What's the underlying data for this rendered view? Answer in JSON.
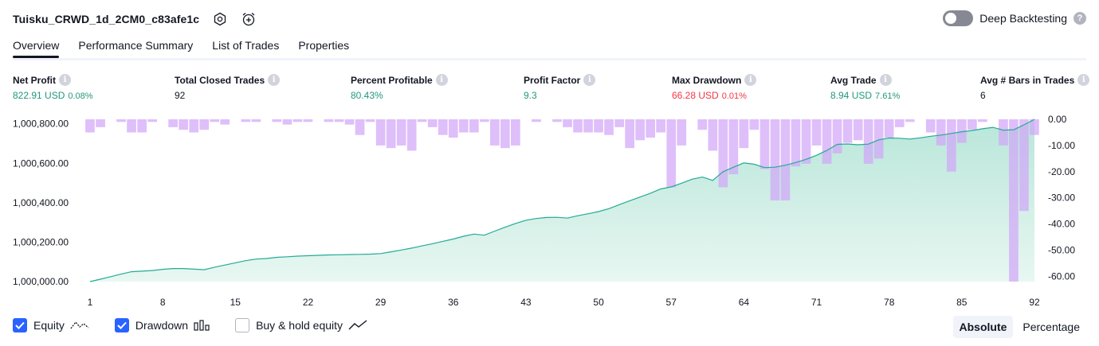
{
  "strategy_name": "Tuisku_CRWD_1d_2CM0_c83afe1c",
  "header_icons": [
    "settings-icon",
    "alarm-add-icon"
  ],
  "deep_backtesting": {
    "label": "Deep Backtesting",
    "enabled": false,
    "help": "?"
  },
  "tabs": [
    {
      "label": "Overview",
      "active": true
    },
    {
      "label": "Performance Summary",
      "active": false
    },
    {
      "label": "List of Trades",
      "active": false
    },
    {
      "label": "Properties",
      "active": false
    }
  ],
  "info_glyph": "i",
  "metrics": {
    "net_profit": {
      "label": "Net Profit",
      "value": "822.91 USD",
      "sub": "0.08%"
    },
    "total_closed_trades": {
      "label": "Total Closed Trades",
      "value": "92"
    },
    "percent_profitable": {
      "label": "Percent Profitable",
      "value": "80.43%"
    },
    "profit_factor": {
      "label": "Profit Factor",
      "value": "9.3"
    },
    "max_drawdown": {
      "label": "Max Drawdown",
      "value": "66.28 USD",
      "sub": "0.01%"
    },
    "avg_trade": {
      "label": "Avg Trade",
      "value": "8.94 USD",
      "sub": "7.61%"
    },
    "avg_bars": {
      "label": "Avg # Bars in Trades",
      "value": "6"
    }
  },
  "colors": {
    "equity_line": "#22ab94",
    "equity_fill": "#d4f0e8",
    "drawdown": "#d1a6f8",
    "positive": "#22987b",
    "negative": "#f23645",
    "accent": "#2962ff"
  },
  "chart_data": {
    "type": "bar+area",
    "x_ticks": [
      1,
      8,
      15,
      22,
      29,
      36,
      43,
      50,
      57,
      64,
      71,
      78,
      85,
      92
    ],
    "left_axis": {
      "ylim": [
        1000000,
        1000822.91
      ],
      "ticks": [
        "1,000,000.00",
        "1,000,200.00",
        "1,000,400.00",
        "1,000,600.00",
        "1,000,800.00"
      ]
    },
    "right_axis": {
      "ylim": [
        -62,
        0
      ],
      "ticks": [
        "0.00",
        "-10.00",
        "-20.00",
        "-30.00",
        "-40.00",
        "-50.00",
        "-60.00"
      ]
    },
    "series": [
      {
        "name": "Equity",
        "type": "area",
        "values": [
          1000000,
          1000012,
          1000025,
          1000038,
          1000050,
          1000053,
          1000056,
          1000062,
          1000066,
          1000066,
          1000063,
          1000060,
          1000073,
          1000084,
          1000095,
          1000106,
          1000114,
          1000117,
          1000123,
          1000126,
          1000129,
          1000131,
          1000133,
          1000135,
          1000136,
          1000137,
          1000138,
          1000139,
          1000142,
          1000151,
          1000160,
          1000170,
          1000181,
          1000192,
          1000204,
          1000216,
          1000230,
          1000241,
          1000235,
          1000256,
          1000276,
          1000295,
          1000311,
          1000320,
          1000325,
          1000326,
          1000322,
          1000334,
          1000344,
          1000355,
          1000370,
          1000390,
          1000410,
          1000429,
          1000448,
          1000470,
          1000480,
          1000499,
          1000519,
          1000530,
          1000513,
          1000557,
          1000580,
          1000602,
          1000595,
          1000578,
          1000580,
          1000590,
          1000604,
          1000620,
          1000640,
          1000665,
          1000696,
          1000698,
          1000694,
          1000697,
          1000719,
          1000728,
          1000727,
          1000723,
          1000729,
          1000737,
          1000743,
          1000751,
          1000760,
          1000766,
          1000775,
          1000782,
          1000768,
          1000770,
          1000795,
          1000822.91
        ]
      },
      {
        "name": "Drawdown",
        "type": "bar",
        "values": [
          -5,
          -3,
          0,
          -1,
          -5,
          -5,
          -1,
          0,
          -3,
          -4,
          -5,
          -4,
          -1,
          -2,
          0,
          -1,
          -1,
          0,
          -1,
          -2,
          -1,
          -1,
          0,
          -1,
          -1,
          -2,
          -6,
          -1,
          -10,
          -11,
          -10,
          -12,
          -1,
          -3,
          -6,
          -7,
          -5,
          -5,
          -1,
          -10,
          -11,
          -10,
          0,
          -1,
          0,
          -1,
          -3,
          -5,
          -5,
          -5,
          -6,
          -3,
          -11,
          -8,
          -7,
          -5,
          -26,
          -10,
          0,
          -4,
          -12,
          -26,
          -21,
          -11,
          -4,
          -19,
          -31,
          -31,
          -18,
          -17,
          -10,
          -17,
          -13,
          -9,
          -8,
          -17,
          -15,
          -7,
          -3,
          -1,
          0,
          -5,
          -10,
          -20,
          -9,
          -4,
          -1,
          0,
          -10,
          -62,
          -35,
          -6
        ]
      }
    ],
    "title": "",
    "xlabel": "",
    "ylabel": "",
    "grid": false
  },
  "legend": [
    {
      "label": "Equity",
      "checked": true,
      "glyph": "equity-line-icon"
    },
    {
      "label": "Drawdown",
      "checked": true,
      "glyph": "drawdown-bars-icon"
    },
    {
      "label": "Buy & hold equity",
      "checked": false,
      "glyph": "buy-hold-line-icon"
    }
  ],
  "modes": [
    {
      "label": "Absolute",
      "active": true
    },
    {
      "label": "Percentage",
      "active": false
    }
  ]
}
